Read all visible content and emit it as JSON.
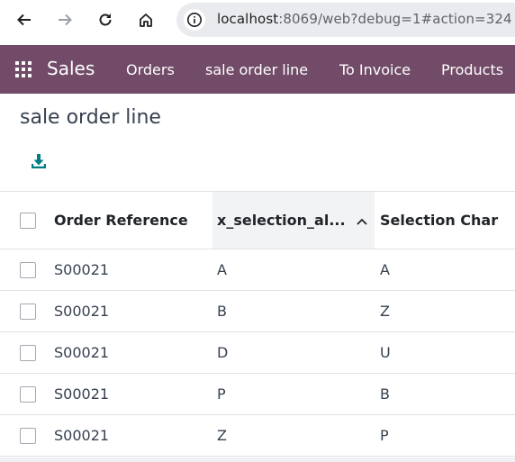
{
  "browser": {
    "url_host": "localhost",
    "url_rest": ":8069/web?debug=1#action=324"
  },
  "navbar": {
    "brand": "Sales",
    "menu": [
      "Orders",
      "sale order line",
      "To Invoice",
      "Products"
    ],
    "color": "#714b67"
  },
  "page": {
    "title": "sale order line"
  },
  "table": {
    "columns": [
      "Order Reference",
      "x_selection_al...",
      "Selection Char"
    ],
    "rows": [
      [
        "S00021",
        "A",
        "A"
      ],
      [
        "S00021",
        "B",
        "Z"
      ],
      [
        "S00021",
        "D",
        "U"
      ],
      [
        "S00021",
        "P",
        "B"
      ],
      [
        "S00021",
        "Z",
        "P"
      ]
    ]
  }
}
